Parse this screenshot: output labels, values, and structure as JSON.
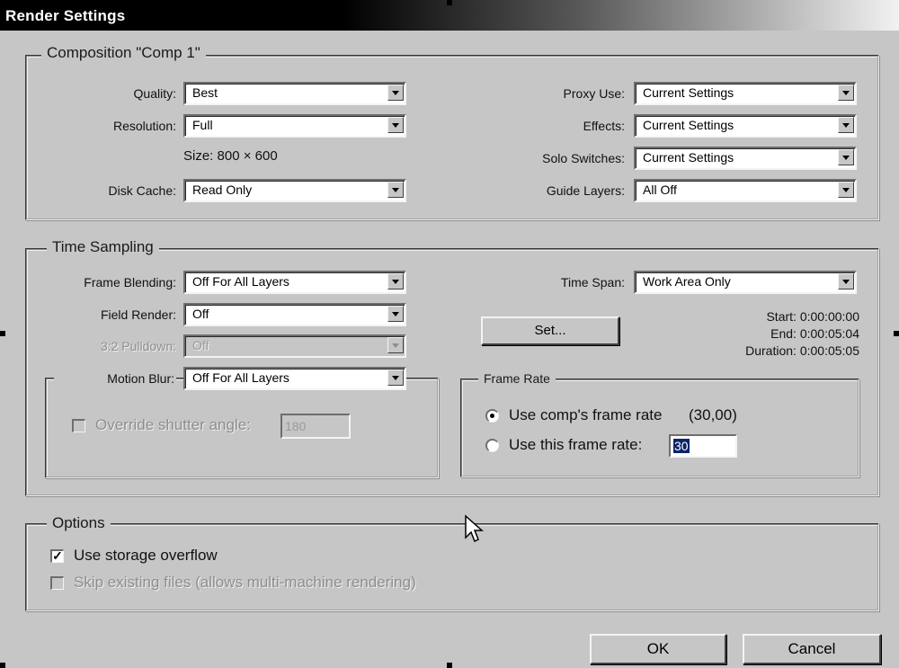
{
  "window": {
    "title": "Render Settings"
  },
  "composition": {
    "group_label": "Composition \"Comp 1\"",
    "quality": {
      "label": "Quality:",
      "value": "Best"
    },
    "resolution": {
      "label": "Resolution:",
      "value": "Full"
    },
    "size_text": "Size: 800 × 600",
    "disk_cache": {
      "label": "Disk Cache:",
      "value": "Read Only"
    },
    "proxy_use": {
      "label": "Proxy Use:",
      "value": "Current Settings"
    },
    "effects": {
      "label": "Effects:",
      "value": "Current Settings"
    },
    "solo_switches": {
      "label": "Solo Switches:",
      "value": "Current Settings"
    },
    "guide_layers": {
      "label": "Guide Layers:",
      "value": "All Off"
    }
  },
  "time_sampling": {
    "group_label": "Time Sampling",
    "frame_blending": {
      "label": "Frame Blending:",
      "value": "Off For All Layers"
    },
    "field_render": {
      "label": "Field Render:",
      "value": "Off"
    },
    "pulldown": {
      "label": "3:2 Pulldown:",
      "value": "Off"
    },
    "motion_blur": {
      "label": "Motion Blur:",
      "value": "Off For All Layers"
    },
    "override_shutter": {
      "label": "Override shutter angle:",
      "value": "180",
      "checked": false
    },
    "time_span": {
      "label": "Time Span:",
      "value": "Work Area Only"
    },
    "set_button": "Set...",
    "start": "Start: 0:00:00:00",
    "end": "End: 0:00:05:04",
    "duration": "Duration: 0:00:05:05",
    "frame_rate": {
      "group_label": "Frame Rate",
      "use_comp": "Use comp's frame rate",
      "comp_rate": "(30,00)",
      "use_this": "Use this frame rate:",
      "this_value": "30",
      "selected": "use_comp"
    }
  },
  "options": {
    "group_label": "Options",
    "storage_overflow": {
      "label": "Use storage overflow",
      "checked": true
    },
    "skip_existing": {
      "label": "Skip existing files (allows multi-machine rendering)",
      "checked": false
    }
  },
  "buttons": {
    "ok": "OK",
    "cancel": "Cancel"
  }
}
